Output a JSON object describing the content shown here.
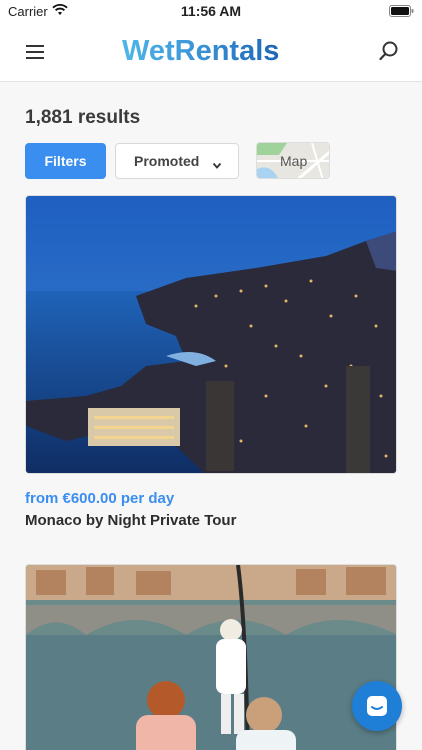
{
  "status_bar": {
    "carrier": "Carrier",
    "time": "11:56 AM"
  },
  "header": {
    "logo_text": "WetRentals"
  },
  "results": {
    "count_text": "1,881 results"
  },
  "toolbar": {
    "filters_label": "Filters",
    "sort_label": "Promoted",
    "map_label": "Map"
  },
  "listings": [
    {
      "price_text": "from €600.00 per day",
      "title": "Monaco by Night Private Tour"
    }
  ],
  "colors": {
    "accent": "#3a8ef0",
    "chat": "#1f7fd6",
    "logo_light": "#4fb6e8",
    "logo_dark": "#1f66b5"
  },
  "icons": [
    "wifi-icon",
    "battery-icon",
    "menu-icon",
    "search-icon",
    "chevron-down-icon",
    "chat-icon"
  ]
}
